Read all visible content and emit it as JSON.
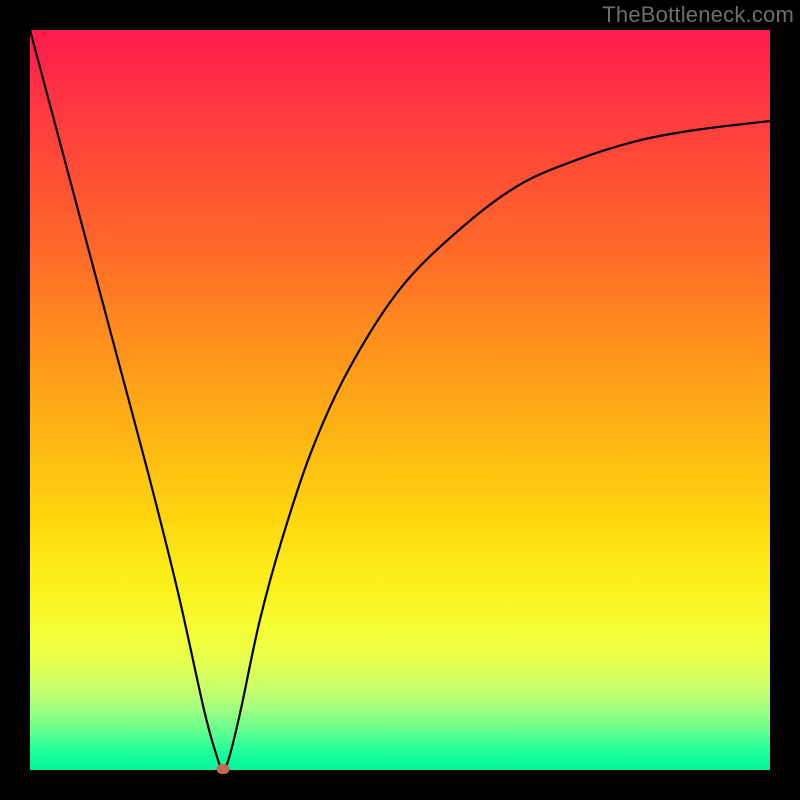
{
  "watermark": "TheBottleneck.com",
  "chart_data": {
    "type": "line",
    "title": "",
    "xlabel": "",
    "ylabel": "",
    "xlim": [
      0,
      1
    ],
    "ylim": [
      0,
      1
    ],
    "grid": false,
    "legend": false,
    "note": "No axis ticks or labels are shown; values are normalized 0-1. The image is a bottleneck curve descending from top-left to a minimum near x≈0.26 then rising asymptotically toward the right.",
    "series": [
      {
        "name": "bottleneck-curve",
        "x": [
          0.0,
          0.04,
          0.08,
          0.12,
          0.16,
          0.2,
          0.235,
          0.252,
          0.261,
          0.27,
          0.285,
          0.31,
          0.34,
          0.38,
          0.43,
          0.5,
          0.58,
          0.66,
          0.74,
          0.82,
          0.9,
          1.0
        ],
        "values": [
          1.0,
          0.85,
          0.7,
          0.55,
          0.4,
          0.24,
          0.082,
          0.02,
          0.0,
          0.02,
          0.082,
          0.2,
          0.31,
          0.43,
          0.54,
          0.65,
          0.73,
          0.79,
          0.825,
          0.85,
          0.865,
          0.877
        ]
      }
    ],
    "marker": {
      "name": "min-point",
      "x": 0.261,
      "y": 0.002
    },
    "colors": {
      "curve": "#000000",
      "marker": "#c36b52",
      "gradient_top": "#ff1a4d",
      "gradient_bottom": "#00f59b",
      "frame": "#000000",
      "watermark": "#6e6e6e"
    }
  }
}
